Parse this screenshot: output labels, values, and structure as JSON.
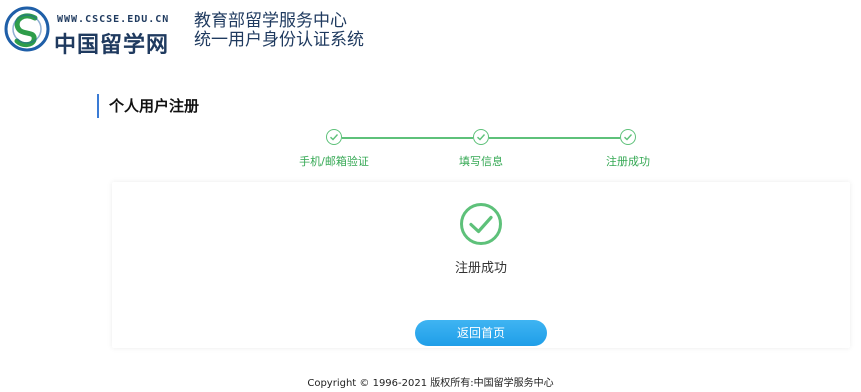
{
  "header": {
    "logo_url": "WWW.CSCSE.EDU.CN",
    "logo_name": "中国留学网",
    "org_line1": "教育部留学服务中心",
    "org_line2": "统一用户身份认证系统"
  },
  "page_title": "个人用户注册",
  "steps": [
    {
      "label": "手机/邮箱验证",
      "status": "done"
    },
    {
      "label": "填写信息",
      "status": "done"
    },
    {
      "label": "注册成功",
      "status": "done"
    }
  ],
  "result": {
    "message": "注册成功",
    "home_button_label": "返回首页"
  },
  "footer": {
    "copyright": "Copyright © 1996-2021 版权所有:中国留学服务中心"
  },
  "colors": {
    "brand": "#1f3a5f",
    "step_green": "#5ec17a",
    "button_blue": "#27a5ea"
  },
  "icons": {
    "logo": "cscse-logo-icon",
    "step_check": "check-icon",
    "success": "success-check-icon"
  }
}
